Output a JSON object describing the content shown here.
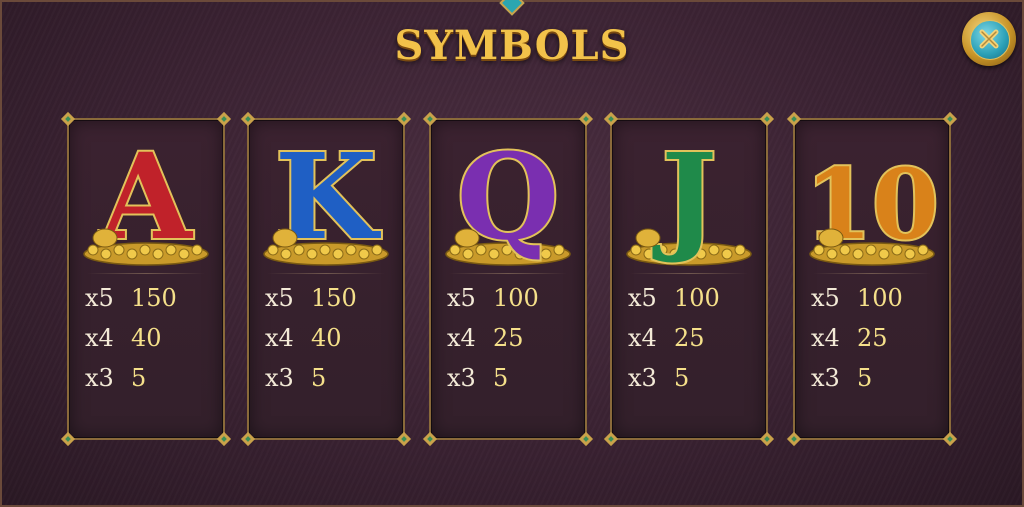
{
  "title": "SYMBOLS",
  "close_icon": "close-icon",
  "symbols": [
    {
      "name": "A",
      "color": "#c0222a",
      "accent": "red-letter-with-scarab",
      "payouts": [
        {
          "mult": "x5",
          "value": "150"
        },
        {
          "mult": "x4",
          "value": "40"
        },
        {
          "mult": "x3",
          "value": "5"
        }
      ]
    },
    {
      "name": "K",
      "color": "#1f5fc4",
      "accent": "blue-letter-with-anubis",
      "payouts": [
        {
          "mult": "x5",
          "value": "150"
        },
        {
          "mult": "x4",
          "value": "40"
        },
        {
          "mult": "x3",
          "value": "5"
        }
      ]
    },
    {
      "name": "Q",
      "color": "#7a2fb0",
      "accent": "purple-letter-with-falcon",
      "payouts": [
        {
          "mult": "x5",
          "value": "100"
        },
        {
          "mult": "x4",
          "value": "25"
        },
        {
          "mult": "x3",
          "value": "5"
        }
      ]
    },
    {
      "name": "J",
      "color": "#1f8a4a",
      "accent": "green-letter-with-ankh",
      "payouts": [
        {
          "mult": "x5",
          "value": "100"
        },
        {
          "mult": "x4",
          "value": "25"
        },
        {
          "mult": "x3",
          "value": "5"
        }
      ]
    },
    {
      "name": "10",
      "color": "#d9821a",
      "accent": "orange-number-with-coins",
      "payouts": [
        {
          "mult": "x5",
          "value": "100"
        },
        {
          "mult": "x4",
          "value": "25"
        },
        {
          "mult": "x3",
          "value": "5"
        }
      ]
    }
  ]
}
